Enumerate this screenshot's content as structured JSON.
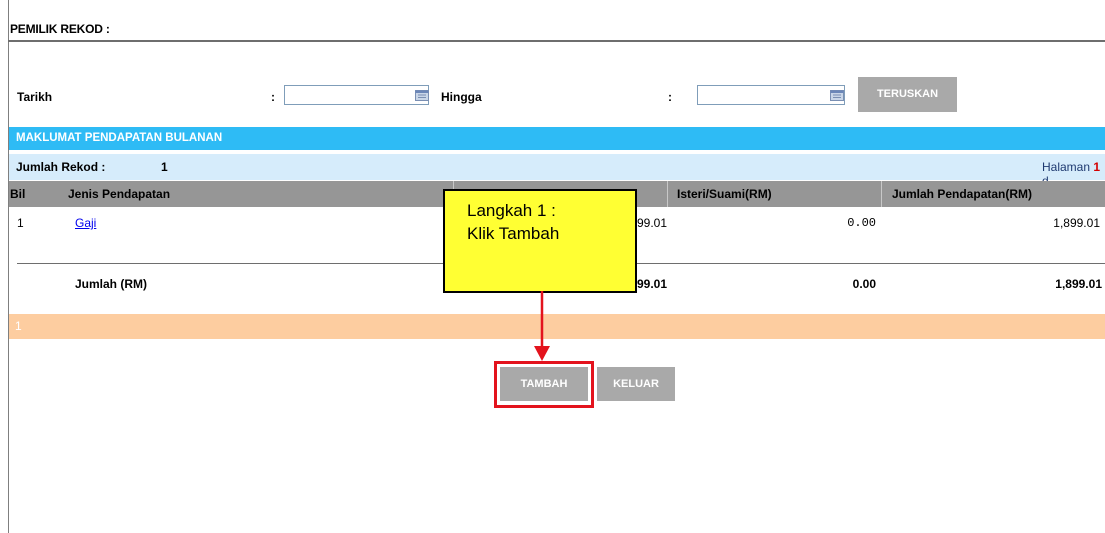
{
  "header": {
    "owner_label": "PEMILIK REKOD :"
  },
  "filter": {
    "from_label": "Tarikh",
    "colon": ":",
    "from_value": "",
    "to_label": "Hingga",
    "to_value": "",
    "submit_label": "TERUSKAN"
  },
  "section": {
    "title": "MAKLUMAT PENDAPATAN BULANAN"
  },
  "summary": {
    "count_label": "Jumlah Rekod :",
    "count_value": "1",
    "page_prefix": "Halaman",
    "page_current": "1",
    "page_suffix": "d"
  },
  "table": {
    "columns": [
      "Bil",
      "Jenis Pendapatan",
      "",
      "Isteri/Suami(RM)",
      "Jumlah Pendapatan(RM)"
    ],
    "rows": [
      {
        "bil": "1",
        "jenis": "Gaji",
        "amount": "99.01",
        "spouse": "0.00",
        "total": "1,899.01"
      }
    ],
    "total_label": "Jumlah (RM)",
    "total_amount": "99.01",
    "total_spouse": "0.00",
    "total_sum": "1,899.01"
  },
  "pager": {
    "pages": "1"
  },
  "actions": {
    "add_label": "TAMBAH",
    "exit_label": "KELUAR"
  },
  "annotation": {
    "line1": "Langkah 1 :",
    "line2": "Klik Tambah",
    "accent_color": "#e3131d",
    "callout_color": "#ffff33"
  }
}
